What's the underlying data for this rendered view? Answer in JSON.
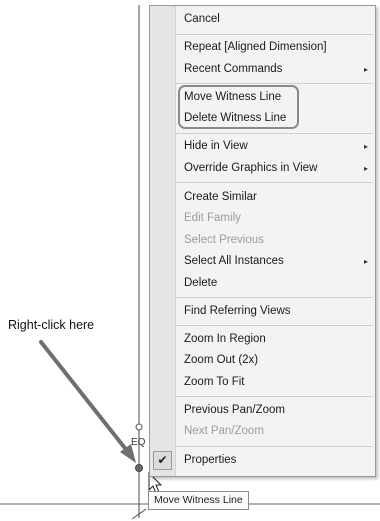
{
  "annotation": {
    "text": "Right-click here"
  },
  "dimension": {
    "label": "EQ"
  },
  "menu": {
    "items": [
      {
        "label": "Cancel",
        "enabled": true,
        "submenu": false
      },
      {
        "label": "Repeat [Aligned Dimension]",
        "enabled": true,
        "submenu": false
      },
      {
        "label": "Recent Commands",
        "enabled": true,
        "submenu": true
      },
      {
        "label": "Move Witness Line",
        "enabled": true,
        "submenu": false
      },
      {
        "label": "Delete Witness Line",
        "enabled": true,
        "submenu": false
      },
      {
        "label": "Hide in View",
        "enabled": true,
        "submenu": true
      },
      {
        "label": "Override Graphics in View",
        "enabled": true,
        "submenu": true
      },
      {
        "label": "Create Similar",
        "enabled": true,
        "submenu": false
      },
      {
        "label": "Edit Family",
        "enabled": false,
        "submenu": false
      },
      {
        "label": "Select Previous",
        "enabled": false,
        "submenu": false
      },
      {
        "label": "Select All Instances",
        "enabled": true,
        "submenu": true
      },
      {
        "label": "Delete",
        "enabled": true,
        "submenu": false
      },
      {
        "label": "Find Referring Views",
        "enabled": true,
        "submenu": false
      },
      {
        "label": "Zoom In Region",
        "enabled": true,
        "submenu": false
      },
      {
        "label": "Zoom Out (2x)",
        "enabled": true,
        "submenu": false
      },
      {
        "label": "Zoom To Fit",
        "enabled": true,
        "submenu": false
      },
      {
        "label": "Previous Pan/Zoom",
        "enabled": true,
        "submenu": false
      },
      {
        "label": "Next Pan/Zoom",
        "enabled": false,
        "submenu": false
      },
      {
        "label": "Properties",
        "enabled": true,
        "submenu": false,
        "checked": true
      }
    ],
    "submenu_arrow": "▸",
    "check_mark": "✔"
  },
  "tooltip": {
    "text": "Move Witness Line"
  },
  "icons": {
    "submenu": "submenu-arrow-icon",
    "check": "checkmark-icon",
    "cursor": "mouse-pointer-icon"
  }
}
